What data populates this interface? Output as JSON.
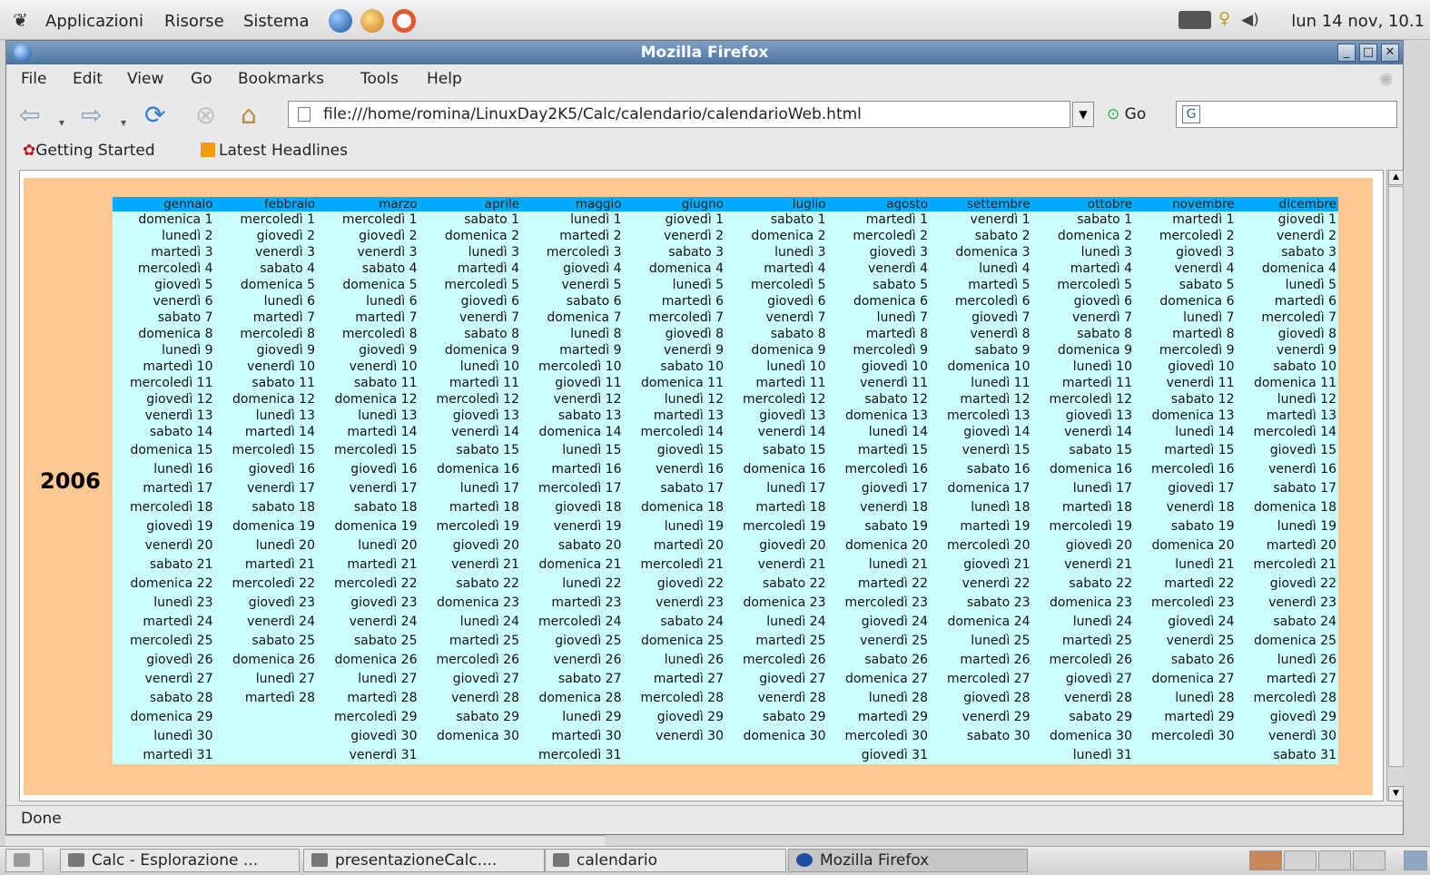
{
  "panel": {
    "menus": [
      "Applicazioni",
      "Risorse",
      "Sistema"
    ],
    "clock": "lun 14 nov, 10.1"
  },
  "window": {
    "title": "Mozilla Firefox"
  },
  "menubar": {
    "items": [
      "File",
      "Edit",
      "View",
      "Go",
      "Bookmarks",
      "Tools",
      "Help"
    ]
  },
  "navbar": {
    "url": "file:///home/romina/LinuxDay2K5/Calc/calendario/calendarioWeb.html",
    "go_label": "Go"
  },
  "bookmarks": [
    "Getting Started",
    "Latest Headlines"
  ],
  "calendar": {
    "year": "2006",
    "months": [
      "gennaio",
      "febbraio",
      "marzo",
      "aprile",
      "maggio",
      "giugno",
      "luglio",
      "agosto",
      "settembre",
      "ottobre",
      "novembre",
      "dicembre"
    ],
    "rows": [
      [
        "domenica 1",
        "mercoledì 1",
        "mercoledì 1",
        "sabato 1",
        "lunedì 1",
        "giovedì 1",
        "sabato 1",
        "martedì 1",
        "venerdì 1",
        "sabato 1",
        "martedì 1",
        "giovedì 1"
      ],
      [
        "lunedì 2",
        "giovedì 2",
        "giovedì 2",
        "domenica 2",
        "martedì 2",
        "venerdì 2",
        "domenica 2",
        "mercoledì 2",
        "sabato 2",
        "domenica 2",
        "mercoledì 2",
        "venerdì 2"
      ],
      [
        "martedì 3",
        "venerdì 3",
        "venerdì 3",
        "lunedì 3",
        "mercoledì 3",
        "sabato 3",
        "lunedì 3",
        "giovedì 3",
        "domenica 3",
        "lunedì 3",
        "giovedì 3",
        "sabato 3"
      ],
      [
        "mercoledì 4",
        "sabato 4",
        "sabato 4",
        "martedì 4",
        "giovedì 4",
        "domenica 4",
        "martedì 4",
        "venerdì 4",
        "lunedì 4",
        "martedì 4",
        "venerdì 4",
        "domenica 4"
      ],
      [
        "giovedì 5",
        "domenica 5",
        "domenica 5",
        "mercoledì 5",
        "venerdì 5",
        "lunedì 5",
        "mercoledì 5",
        "sabato 5",
        "martedì 5",
        "mercoledì 5",
        "sabato 5",
        "lunedì 5"
      ],
      [
        "venerdì 6",
        "lunedì 6",
        "lunedì 6",
        "giovedì 6",
        "sabato 6",
        "martedì 6",
        "giovedì 6",
        "domenica 6",
        "mercoledì 6",
        "giovedì 6",
        "domenica 6",
        "martedì 6"
      ],
      [
        "sabato 7",
        "martedì 7",
        "martedì 7",
        "venerdì 7",
        "domenica 7",
        "mercoledì 7",
        "venerdì 7",
        "lunedì 7",
        "giovedì 7",
        "venerdì 7",
        "lunedì 7",
        "mercoledì 7"
      ],
      [
        "domenica 8",
        "mercoledì 8",
        "mercoledì 8",
        "sabato 8",
        "lunedì 8",
        "giovedì 8",
        "sabato 8",
        "martedì 8",
        "venerdì 8",
        "sabato 8",
        "martedì 8",
        "giovedì 8"
      ],
      [
        "lunedì 9",
        "giovedì 9",
        "giovedì 9",
        "domenica 9",
        "martedì 9",
        "venerdì 9",
        "domenica 9",
        "mercoledì 9",
        "sabato 9",
        "domenica 9",
        "mercoledì 9",
        "venerdì 9"
      ],
      [
        "martedì 10",
        "venerdì 10",
        "venerdì 10",
        "lunedì 10",
        "mercoledì 10",
        "sabato 10",
        "lunedì 10",
        "giovedì 10",
        "domenica 10",
        "lunedì 10",
        "giovedì 10",
        "sabato 10"
      ],
      [
        "mercoledì 11",
        "sabato 11",
        "sabato 11",
        "martedì 11",
        "giovedì 11",
        "domenica 11",
        "martedì 11",
        "venerdì 11",
        "lunedì 11",
        "martedì 11",
        "venerdì 11",
        "domenica 11"
      ],
      [
        "giovedì 12",
        "domenica 12",
        "domenica 12",
        "mercoledì 12",
        "venerdì 12",
        "lunedì 12",
        "mercoledì 12",
        "sabato 12",
        "martedì 12",
        "mercoledì 12",
        "sabato 12",
        "lunedì 12"
      ],
      [
        "venerdì 13",
        "lunedì 13",
        "lunedì 13",
        "giovedì 13",
        "sabato 13",
        "martedì 13",
        "giovedì 13",
        "domenica 13",
        "mercoledì 13",
        "giovedì 13",
        "domenica 13",
        "martedì 13"
      ],
      [
        "sabato 14",
        "martedì 14",
        "martedì 14",
        "venerdì 14",
        "domenica 14",
        "mercoledì 14",
        "venerdì 14",
        "lunedì 14",
        "giovedì 14",
        "venerdì 14",
        "lunedì 14",
        "mercoledì 14"
      ],
      [
        "domenica 15",
        "mercoledì 15",
        "mercoledì 15",
        "sabato 15",
        "lunedì 15",
        "giovedì 15",
        "sabato 15",
        "martedì 15",
        "venerdì 15",
        "sabato 15",
        "martedì 15",
        "giovedì 15"
      ],
      [
        "lunedì 16",
        "giovedì 16",
        "giovedì 16",
        "domenica 16",
        "martedì 16",
        "venerdì 16",
        "domenica 16",
        "mercoledì 16",
        "sabato 16",
        "domenica 16",
        "mercoledì 16",
        "venerdì 16"
      ],
      [
        "martedì 17",
        "venerdì 17",
        "venerdì 17",
        "lunedì 17",
        "mercoledì 17",
        "sabato 17",
        "lunedì 17",
        "giovedì 17",
        "domenica 17",
        "lunedì 17",
        "giovedì 17",
        "sabato 17"
      ],
      [
        "mercoledì 18",
        "sabato 18",
        "sabato 18",
        "martedì 18",
        "giovedì 18",
        "domenica 18",
        "martedì 18",
        "venerdì 18",
        "lunedì 18",
        "martedì 18",
        "venerdì 18",
        "domenica 18"
      ],
      [
        "giovedì 19",
        "domenica 19",
        "domenica 19",
        "mercoledì 19",
        "venerdì 19",
        "lunedì 19",
        "mercoledì 19",
        "sabato 19",
        "martedì 19",
        "mercoledì 19",
        "sabato 19",
        "lunedì 19"
      ],
      [
        "venerdì 20",
        "lunedì 20",
        "lunedì 20",
        "giovedì 20",
        "sabato 20",
        "martedì 20",
        "giovedì 20",
        "domenica 20",
        "mercoledì 20",
        "giovedì 20",
        "domenica 20",
        "martedì 20"
      ],
      [
        "sabato 21",
        "martedì 21",
        "martedì 21",
        "venerdì 21",
        "domenica 21",
        "mercoledì 21",
        "venerdì 21",
        "lunedì 21",
        "giovedì 21",
        "venerdì 21",
        "lunedì 21",
        "mercoledì 21"
      ],
      [
        "domenica 22",
        "mercoledì 22",
        "mercoledì 22",
        "sabato 22",
        "lunedì 22",
        "giovedì 22",
        "sabato 22",
        "martedì 22",
        "venerdì 22",
        "sabato 22",
        "martedì 22",
        "giovedì 22"
      ],
      [
        "lunedì 23",
        "giovedì 23",
        "giovedì 23",
        "domenica 23",
        "martedì 23",
        "venerdì 23",
        "domenica 23",
        "mercoledì 23",
        "sabato 23",
        "domenica 23",
        "mercoledì 23",
        "venerdì 23"
      ],
      [
        "martedì 24",
        "venerdì 24",
        "venerdì 24",
        "lunedì 24",
        "mercoledì 24",
        "sabato 24",
        "lunedì 24",
        "giovedì 24",
        "domenica 24",
        "lunedì 24",
        "giovedì 24",
        "sabato 24"
      ],
      [
        "mercoledì 25",
        "sabato 25",
        "sabato 25",
        "martedì 25",
        "giovedì 25",
        "domenica 25",
        "martedì 25",
        "venerdì 25",
        "lunedì 25",
        "martedì 25",
        "venerdì 25",
        "domenica 25"
      ],
      [
        "giovedì 26",
        "domenica 26",
        "domenica 26",
        "mercoledì 26",
        "venerdì 26",
        "lunedì 26",
        "mercoledì 26",
        "sabato 26",
        "martedì 26",
        "mercoledì 26",
        "sabato 26",
        "lunedì 26"
      ],
      [
        "venerdì 27",
        "lunedì 27",
        "lunedì 27",
        "giovedì 27",
        "sabato 27",
        "martedì 27",
        "giovedì 27",
        "domenica 27",
        "mercoledì 27",
        "giovedì 27",
        "domenica 27",
        "martedì 27"
      ],
      [
        "sabato 28",
        "martedì 28",
        "martedì 28",
        "venerdì 28",
        "domenica 28",
        "mercoledì 28",
        "venerdì 28",
        "lunedì 28",
        "giovedì 28",
        "venerdì 28",
        "lunedì 28",
        "mercoledì 28"
      ],
      [
        "domenica 29",
        "",
        "mercoledì 29",
        "sabato 29",
        "lunedì 29",
        "giovedì 29",
        "sabato 29",
        "martedì 29",
        "venerdì 29",
        "sabato 29",
        "martedì 29",
        "giovedì 29"
      ],
      [
        "lunedì 30",
        "",
        "giovedì 30",
        "domenica 30",
        "martedì 30",
        "venerdì 30",
        "domenica 30",
        "mercoledì 30",
        "sabato 30",
        "domenica 30",
        "mercoledì 30",
        "venerdì 30"
      ],
      [
        "martedì 31",
        "",
        "venerdì 31",
        "",
        "mercoledì 31",
        "",
        "",
        "giovedì 31",
        "",
        "lunedì 31",
        "",
        "sabato 31"
      ]
    ]
  },
  "status": "Done",
  "taskbar": [
    "Calc - Esplorazione ...",
    "presentazioneCalc....",
    "calendario",
    "Mozilla Firefox"
  ],
  "icons": {
    "foot": "gnome-foot-icon",
    "globe": "globe-icon",
    "back": "back-arrow-icon",
    "forward": "forward-arrow-icon",
    "reload": "reload-icon",
    "stop": "stop-icon",
    "home": "home-icon"
  }
}
